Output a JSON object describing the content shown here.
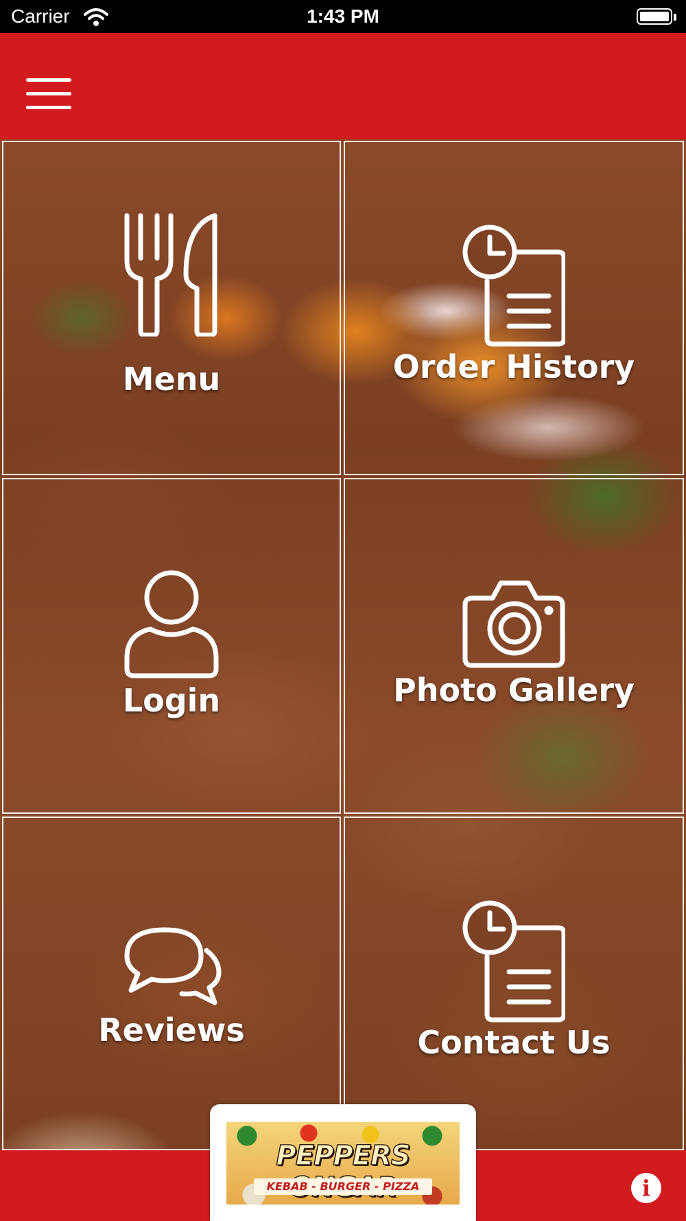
{
  "status_bar": {
    "carrier": "Carrier",
    "time": "1:43 PM"
  },
  "colors": {
    "brand_red": "#d21b1f",
    "tile_border": "#ffffff",
    "label_text": "#ffffff"
  },
  "header": {
    "menu_icon": "hamburger-icon"
  },
  "tiles": [
    {
      "label": "Menu",
      "icon": "fork-knife-icon"
    },
    {
      "label": "Order History",
      "icon": "clock-document-icon"
    },
    {
      "label": "Login",
      "icon": "user-icon"
    },
    {
      "label": "Photo Gallery",
      "icon": "camera-icon"
    },
    {
      "label": "Reviews",
      "icon": "chat-bubbles-icon"
    },
    {
      "label": "Contact Us",
      "icon": "clock-document-icon"
    }
  ],
  "footer": {
    "logo_title": "PEPPERS ONGAR",
    "logo_subtitle": "KEBAB - BURGER - PIZZA",
    "info_icon": "info-icon"
  }
}
